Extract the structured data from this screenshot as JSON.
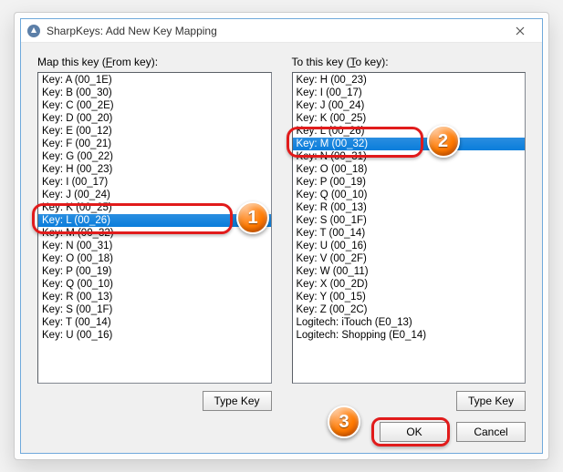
{
  "window": {
    "title": "SharpKeys: Add New Key Mapping"
  },
  "left": {
    "label_pre": "Map this key (",
    "label_u": "F",
    "label_post": "rom key):",
    "items": [
      "Key: A (00_1E)",
      "Key: B (00_30)",
      "Key: C (00_2E)",
      "Key: D (00_20)",
      "Key: E (00_12)",
      "Key: F (00_21)",
      "Key: G (00_22)",
      "Key: H (00_23)",
      "Key: I (00_17)",
      "Key: J (00_24)",
      "Key: K (00_25)",
      "Key: L (00_26)",
      "Key: M (00_32)",
      "Key: N (00_31)",
      "Key: O (00_18)",
      "Key: P (00_19)",
      "Key: Q (00_10)",
      "Key: R (00_13)",
      "Key: S (00_1F)",
      "Key: T (00_14)",
      "Key: U (00_16)"
    ],
    "selectedIndex": 11,
    "typekey": "Type Key"
  },
  "right": {
    "label_pre": "To this key (",
    "label_u": "T",
    "label_post": "o key):",
    "items": [
      "Key: H (00_23)",
      "Key: I (00_17)",
      "Key: J (00_24)",
      "Key: K (00_25)",
      "Key: L (00_26)",
      "Key: M (00_32)",
      "Key: N (00_31)",
      "Key: O (00_18)",
      "Key: P (00_19)",
      "Key: Q (00_10)",
      "Key: R (00_13)",
      "Key: S (00_1F)",
      "Key: T (00_14)",
      "Key: U (00_16)",
      "Key: V (00_2F)",
      "Key: W (00_11)",
      "Key: X (00_2D)",
      "Key: Y (00_15)",
      "Key: Z (00_2C)",
      "Logitech: iTouch (E0_13)",
      "Logitech: Shopping (E0_14)"
    ],
    "selectedIndex": 5,
    "typekey": "Type Key"
  },
  "buttons": {
    "ok": "OK",
    "cancel": "Cancel"
  },
  "annotations": {
    "b1": "1",
    "b2": "2",
    "b3": "3"
  }
}
